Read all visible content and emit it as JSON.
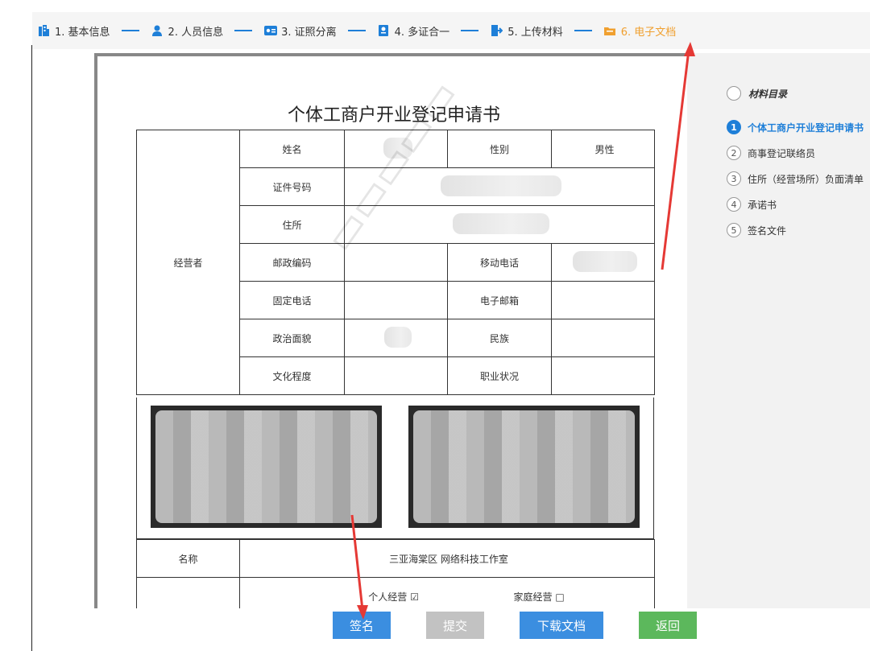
{
  "steps": [
    {
      "label": "1. 基本信息",
      "icon": "building-icon",
      "color": "#1e7fd8"
    },
    {
      "label": "2. 人员信息",
      "icon": "person-icon",
      "color": "#1e7fd8"
    },
    {
      "label": "3. 证照分离",
      "icon": "id-card-icon",
      "color": "#1e7fd8"
    },
    {
      "label": "4. 多证合一",
      "icon": "certificate-icon",
      "color": "#1e7fd8"
    },
    {
      "label": "5. 上传材料",
      "icon": "upload-icon",
      "color": "#1e7fd8"
    },
    {
      "label": "6. 电子文档",
      "icon": "folder-icon",
      "color": "#f0a030"
    }
  ],
  "document": {
    "title": "个体工商户开业登记申请书",
    "section_operator": "经营者",
    "labels": {
      "name": "姓名",
      "gender": "性别",
      "id_number": "证件号码",
      "address": "住所",
      "postal": "邮政编码",
      "mobile": "移动电话",
      "phone": "固定电话",
      "email": "电子邮箱",
      "political": "政治面貌",
      "ethnic": "民族",
      "education": "文化程度",
      "occupation": "职业状况",
      "biz_name": "名称"
    },
    "values": {
      "gender": "男性",
      "biz_name": "三亚海棠区   网络科技工作室"
    },
    "operation_options": [
      {
        "label": "个人经营",
        "mark": "☑"
      },
      {
        "label": "家庭经营",
        "mark": "□"
      }
    ]
  },
  "sidebar": {
    "heading": "材料目录",
    "items": [
      {
        "num": "1",
        "label": "个体工商户开业登记申请书",
        "active": true
      },
      {
        "num": "2",
        "label": "商事登记联络员",
        "active": false
      },
      {
        "num": "3",
        "label": "住所（经营场所）负面清单",
        "active": false
      },
      {
        "num": "4",
        "label": "承诺书",
        "active": false
      },
      {
        "num": "5",
        "label": "签名文件",
        "active": false
      }
    ]
  },
  "buttons": {
    "sign": "签名",
    "submit": "提交",
    "download": "下载文档",
    "back": "返回"
  },
  "colors": {
    "accent": "#1e7fd8",
    "active_step": "#f0a030",
    "annotation_arrow": "#e53935"
  }
}
